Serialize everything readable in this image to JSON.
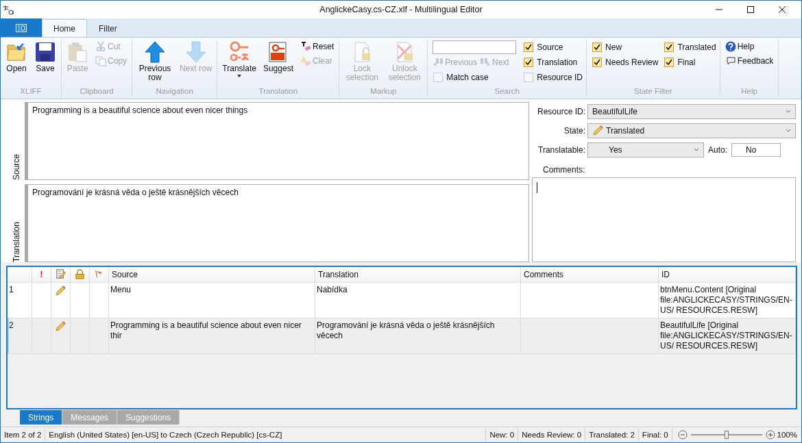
{
  "window": {
    "title": "AnglickeCasy.cs-CZ.xlf - Multilingual Editor"
  },
  "ribbon": {
    "tabs": [
      {
        "label": "Home",
        "selected": true
      },
      {
        "label": "Filter",
        "selected": false
      }
    ],
    "groups": [
      {
        "label": "XLIFF",
        "columns": [
          [
            {
              "kind": "large",
              "label": "Open",
              "disabled": false
            }
          ],
          [
            {
              "kind": "large",
              "label": "Save",
              "disabled": false
            }
          ]
        ]
      },
      {
        "label": "Clipboard",
        "columns": [
          [
            {
              "kind": "large",
              "label": "Paste",
              "disabled": true
            }
          ],
          [
            {
              "kind": "small",
              "label": "Cut",
              "disabled": true
            },
            {
              "kind": "small",
              "label": "Copy",
              "disabled": true
            }
          ]
        ]
      },
      {
        "label": "Navigation",
        "columns": [
          [
            {
              "kind": "large",
              "label": "Previous row",
              "disabled": false
            }
          ],
          [
            {
              "kind": "large",
              "label": "Next row",
              "disabled": true
            }
          ]
        ]
      },
      {
        "label": "Translation",
        "columns": [
          [
            {
              "kind": "large",
              "label": "Translate",
              "disabled": false,
              "dropdown": true
            }
          ],
          [
            {
              "kind": "large",
              "label": "Suggest",
              "disabled": false
            }
          ],
          [
            {
              "kind": "small",
              "label": "Reset",
              "disabled": false
            },
            {
              "kind": "small",
              "label": "Clear",
              "disabled": true
            }
          ]
        ]
      },
      {
        "label": "Markup",
        "columns": [
          [
            {
              "kind": "large",
              "label": "Lock selection",
              "disabled": true
            }
          ],
          [
            {
              "kind": "large",
              "label": "Unlock selection",
              "disabled": true
            }
          ]
        ]
      },
      {
        "label": "Search",
        "columns": [
          [
            {
              "kind": "field"
            },
            {
              "kind": "row",
              "items": [
                {
                  "kind": "small",
                  "label": "Previous",
                  "disabled": true
                },
                {
                  "kind": "small",
                  "label": "Next",
                  "disabled": true
                }
              ]
            },
            {
              "kind": "check",
              "label": "Match case",
              "checked": false
            }
          ],
          [
            {
              "kind": "check",
              "label": "Source",
              "checked": true
            },
            {
              "kind": "check",
              "label": "Translation",
              "checked": true
            },
            {
              "kind": "check",
              "label": "Resource ID",
              "checked": false
            }
          ]
        ]
      },
      {
        "label": "State Filter",
        "columns": [
          [
            {
              "kind": "check",
              "label": "New",
              "checked": true
            },
            {
              "kind": "check",
              "label": "Needs Review",
              "checked": true
            }
          ],
          [
            {
              "kind": "check",
              "label": "Translated",
              "checked": true
            },
            {
              "kind": "check",
              "label": "Final",
              "checked": true
            }
          ]
        ]
      },
      {
        "label": "Help",
        "columns": [
          [
            {
              "kind": "small",
              "label": "Help",
              "disabled": false
            },
            {
              "kind": "small",
              "label": "Feedback",
              "disabled": false
            }
          ]
        ]
      }
    ]
  },
  "editor": {
    "source": {
      "label": "Source",
      "text": "Programming is a beautiful science about even nicer things"
    },
    "translation": {
      "label": "Translation",
      "text": "Programování je krásná věda o ještě krásnějších věcech"
    }
  },
  "properties": {
    "resource_id": {
      "label": "Resource ID:",
      "value": "BeautifulLife"
    },
    "state": {
      "label": "State:",
      "value": "Translated",
      "kind": "translated"
    },
    "translatable": {
      "label": "Translatable:",
      "value": "Yes"
    },
    "auto": {
      "label": "Auto:",
      "value": "No"
    },
    "comments": {
      "label": "Comments:"
    }
  },
  "table": {
    "columns": [
      {
        "kind": "number"
      },
      {
        "kind": "text",
        "label": "!"
      },
      {
        "kind": "state"
      },
      {
        "kind": "lock"
      },
      {
        "kind": "flag"
      },
      {
        "kind": "text",
        "label": "Source"
      },
      {
        "kind": "text",
        "label": "Translation"
      },
      {
        "kind": "text",
        "label": "Comments"
      },
      {
        "kind": "text",
        "label": "ID"
      }
    ],
    "rows": [
      {
        "number": "1",
        "kind": "translated",
        "source": "Menu",
        "translation": "Nabídka",
        "id": "btnMenu.Content [Original file:ANGLICKECASY/STRINGS/EN-US/ RESOURCES.RESW]",
        "selected": false
      },
      {
        "number": "2",
        "kind": "translated",
        "source": "Programming is a beautiful science about even nicer thir",
        "translation": "Programování je krásná věda o ještě krásnějších věcech",
        "id": "BeautifulLife [Original file:ANGLICKECASY/STRINGS/EN-US/ RESOURCES.RESW]",
        "selected": true
      }
    ]
  },
  "bottom_tabs": [
    {
      "label": "Strings",
      "selected": true
    },
    {
      "label": "Messages",
      "selected": false
    },
    {
      "label": "Suggestions",
      "selected": false
    }
  ],
  "status_bar": {
    "item": "Item 2 of 2",
    "languages": "English (United States) [en-US] to Czech (Czech Republic) [cs-CZ]",
    "counts": [
      "New: 0",
      "Needs Review: 0",
      "Translated: 2",
      "Final: 0"
    ],
    "zoom": {
      "level": 0.5,
      "reading": "100%"
    }
  }
}
